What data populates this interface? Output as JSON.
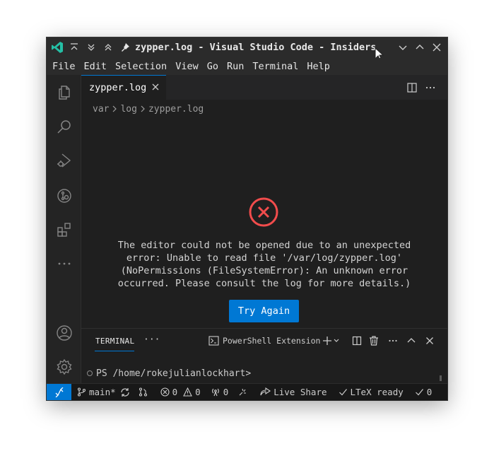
{
  "titlebar": {
    "title": "zypper.log - Visual Studio Code - Insiders"
  },
  "menu": {
    "items": [
      "File",
      "Edit",
      "Selection",
      "View",
      "Go",
      "Run",
      "Terminal",
      "Help"
    ]
  },
  "tab": {
    "label": "zypper.log"
  },
  "breadcrumb": {
    "items": [
      "var",
      "log",
      "zypper.log"
    ]
  },
  "error": {
    "message": "The editor could not be opened due to an unexpected\nerror: Unable to read file '/var/log/zypper.log'\n(NoPermissions (FileSystemError): An unknown error\noccurred. Please consult the log for more details.)",
    "button_label": "Try Again",
    "icon_color": "#f14c4c"
  },
  "panel": {
    "tab_label": "TERMINAL",
    "terminal_name": "PowerShell Extension",
    "prompt": "PS /home/rokejulianlockhart>"
  },
  "statusbar": {
    "branch": "main*",
    "errors": "0",
    "warnings": "0",
    "ports": "0",
    "live_share": "Live Share",
    "ltex": "LTeX ready",
    "checks": "0"
  },
  "colors": {
    "accent": "#0078d4",
    "error": "#f14c4c",
    "background": "#1f1f1f"
  }
}
